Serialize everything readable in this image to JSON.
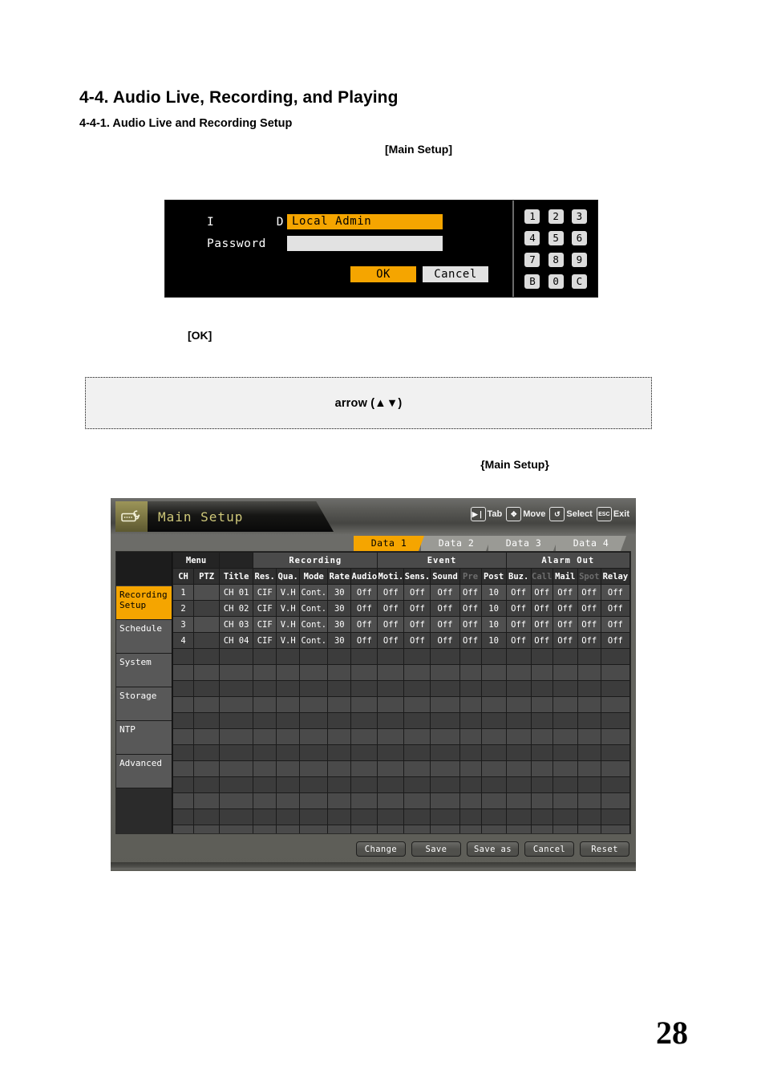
{
  "document": {
    "section_title": "4-4. Audio Live, Recording, and Playing",
    "subsection_title": "4-4-1. Audio Live and Recording Setup",
    "label_main_setup_bracket": "[Main Setup]",
    "label_ok_bracket": "[OK]",
    "note_text": "arrow (▲▼)",
    "label_main_setup_brace": "{Main Setup}",
    "page_number": "28"
  },
  "login_dialog": {
    "id_label": "I D",
    "id_value": "Local Admin",
    "password_label": "Password",
    "password_value": "",
    "ok_button": "OK",
    "cancel_button": "Cancel",
    "keypad": [
      "1",
      "2",
      "3",
      "4",
      "5",
      "6",
      "7",
      "8",
      "9",
      "B",
      "0",
      "C"
    ]
  },
  "dvr": {
    "title": "Main Setup",
    "title_icon": "dvr-wrench-icon",
    "hints": [
      {
        "key": "▶❘",
        "icon": "next-track-icon",
        "label": "Tab"
      },
      {
        "key": "✥",
        "icon": "dpad-move-icon",
        "label": "Move"
      },
      {
        "key": "↺",
        "icon": "enter-select-icon",
        "label": "Select"
      },
      {
        "key": "ESC",
        "icon": "esc-key-icon",
        "label": "Exit"
      }
    ],
    "tabs": [
      {
        "label": "Data 1",
        "active": true
      },
      {
        "label": "Data 2",
        "active": false
      },
      {
        "label": "Data 3",
        "active": false
      },
      {
        "label": "Data 4",
        "active": false
      }
    ],
    "side_menu": [
      {
        "label": "Recording Setup",
        "active": true
      },
      {
        "label": "Schedule",
        "active": false
      },
      {
        "label": "System",
        "active": false
      },
      {
        "label": "Storage",
        "active": false
      },
      {
        "label": "NTP",
        "active": false
      },
      {
        "label": "Advanced",
        "active": false
      }
    ],
    "table": {
      "group_headers": [
        {
          "label": "Menu",
          "span": 2
        },
        {
          "label": "",
          "span": 1
        },
        {
          "label": "Recording",
          "span": 5
        },
        {
          "label": "Event",
          "span": 5
        },
        {
          "label": "Alarm Out",
          "span": 5
        }
      ],
      "columns": [
        {
          "label": "CH",
          "dim": false
        },
        {
          "label": "PTZ",
          "dim": false
        },
        {
          "label": "Title",
          "dim": false
        },
        {
          "label": "Res.",
          "dim": false
        },
        {
          "label": "Qua.",
          "dim": false
        },
        {
          "label": "Mode",
          "dim": false
        },
        {
          "label": "Rate",
          "dim": false
        },
        {
          "label": "Audio",
          "dim": false
        },
        {
          "label": "Moti.",
          "dim": false
        },
        {
          "label": "Sens.",
          "dim": false
        },
        {
          "label": "Sound",
          "dim": false
        },
        {
          "label": "Pre",
          "dim": true
        },
        {
          "label": "Post",
          "dim": false
        },
        {
          "label": "Buz.",
          "dim": false
        },
        {
          "label": "Call",
          "dim": true
        },
        {
          "label": "Mail",
          "dim": false
        },
        {
          "label": "Spot",
          "dim": true
        },
        {
          "label": "Relay",
          "dim": false
        }
      ],
      "rows": [
        {
          "ch": "1",
          "ptz": "",
          "title": "CH 01",
          "res": "CIF",
          "qua": "V.H",
          "mode": "Cont.",
          "rate": "30",
          "audio": "Off",
          "moti": "Off",
          "sens": "Off",
          "sound": "Off",
          "pre": "Off",
          "post": "10",
          "buz": "Off",
          "call": "Off",
          "mail": "Off",
          "spot": "Off",
          "relay": "Off"
        },
        {
          "ch": "2",
          "ptz": "",
          "title": "CH 02",
          "res": "CIF",
          "qua": "V.H",
          "mode": "Cont.",
          "rate": "30",
          "audio": "Off",
          "moti": "Off",
          "sens": "Off",
          "sound": "Off",
          "pre": "Off",
          "post": "10",
          "buz": "Off",
          "call": "Off",
          "mail": "Off",
          "spot": "Off",
          "relay": "Off"
        },
        {
          "ch": "3",
          "ptz": "",
          "title": "CH 03",
          "res": "CIF",
          "qua": "V.H",
          "mode": "Cont.",
          "rate": "30",
          "audio": "Off",
          "moti": "Off",
          "sens": "Off",
          "sound": "Off",
          "pre": "Off",
          "post": "10",
          "buz": "Off",
          "call": "Off",
          "mail": "Off",
          "spot": "Off",
          "relay": "Off"
        },
        {
          "ch": "4",
          "ptz": "",
          "title": "CH 04",
          "res": "CIF",
          "qua": "V.H",
          "mode": "Cont.",
          "rate": "30",
          "audio": "Off",
          "moti": "Off",
          "sens": "Off",
          "sound": "Off",
          "pre": "Off",
          "post": "10",
          "buz": "Off",
          "call": "Off",
          "mail": "Off",
          "spot": "Off",
          "relay": "Off"
        }
      ],
      "empty_row_count": 13
    },
    "buttons": [
      "Change",
      "Save",
      "Save as",
      "Cancel",
      "Reset"
    ],
    "colors": {
      "accent_orange": "#f5a500",
      "title_gold": "#cfc87a",
      "magenta_value": "#d07ad0",
      "dim_text": "#6e6e6e"
    }
  }
}
